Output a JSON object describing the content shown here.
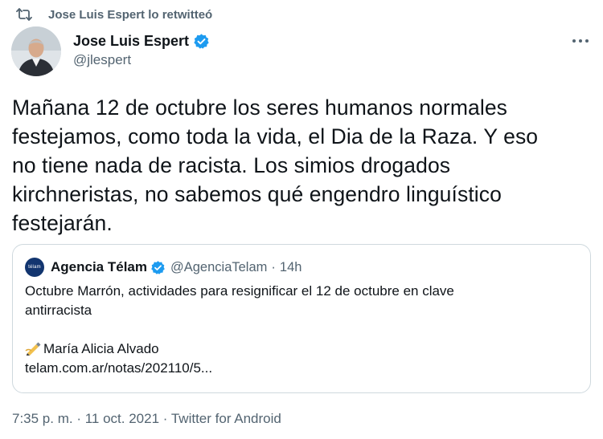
{
  "retweet": {
    "label": "Jose Luis Espert lo retwitteó",
    "icon": "retweet-icon"
  },
  "author": {
    "name": "Jose Luis Espert",
    "handle": "@jlespert",
    "verified": true
  },
  "tweet": {
    "lines": [
      "Mañana 12 de octubre los seres humanos normales",
      "festejamos, como toda la vida, el Dia de la Raza. Y eso",
      "no tiene nada de racista. Los simios drogados",
      "kirchneristas, no sabemos qué engendro linguístico",
      "festejarán."
    ]
  },
  "quote": {
    "logo_text": "télam",
    "name": "Agencia Télam",
    "handle": "@AgenciaTelam",
    "separator": "·",
    "time": "14h",
    "line1": "Octubre Marrón, actividades para resignificar el 12 de octubre en clave",
    "line2": "antirracista",
    "line4": "María Alicia Alvado",
    "line5": "telam.com.ar/notas/202110/5..."
  },
  "meta": {
    "time": "7:35 p. m.",
    "dot1": " · ",
    "date": "11 oct. 2021",
    "dot2": " · ",
    "source": "Twitter for Android"
  },
  "colors": {
    "text": "#0f1419",
    "secondary": "#536471",
    "verified": "#1d9bf0",
    "border": "#cfd9de"
  }
}
